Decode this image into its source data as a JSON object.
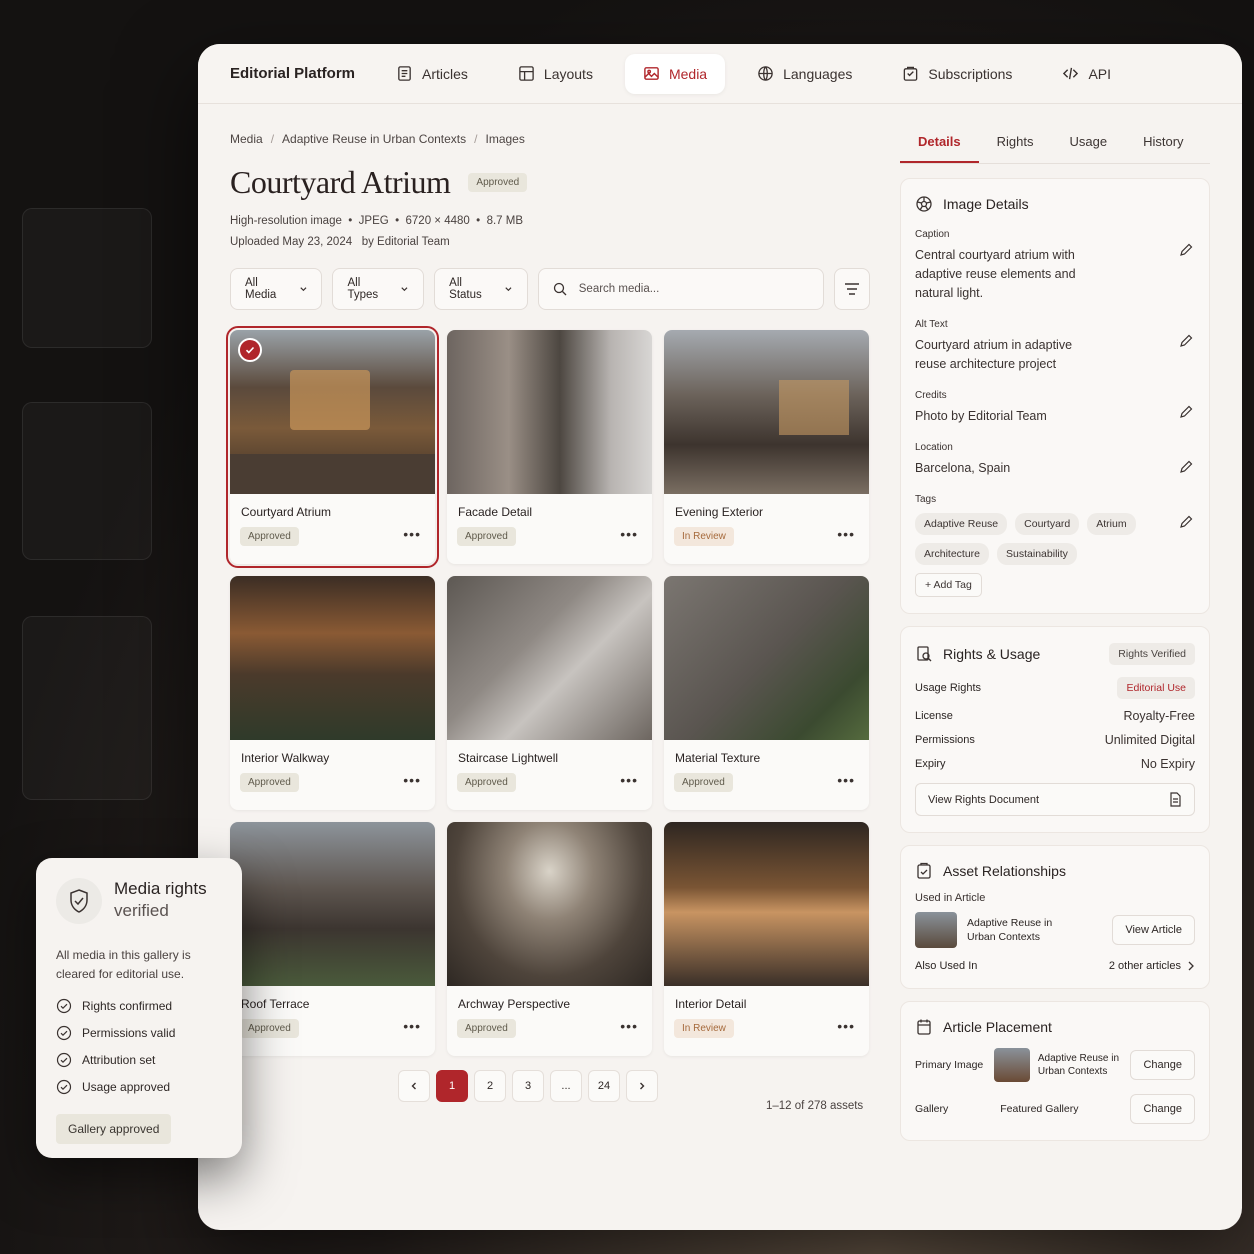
{
  "app": {
    "brand": "Editorial Platform"
  },
  "nav": [
    {
      "label": "Articles",
      "icon": "articles-icon"
    },
    {
      "label": "Layouts",
      "icon": "layouts-icon"
    },
    {
      "label": "Media",
      "icon": "image-icon",
      "active": true
    },
    {
      "label": "Languages",
      "icon": "globe-icon"
    },
    {
      "label": "Subscriptions",
      "icon": "box-icon"
    },
    {
      "label": "API",
      "icon": "code-icon"
    }
  ],
  "breadcrumb": [
    "Media",
    "Adaptive Reuse in Urban Contexts",
    "Images"
  ],
  "asset": {
    "title": "Courtyard Atrium",
    "status": "Approved",
    "meta": "High-resolution image  •  JPEG  •  6720 × 4480  •  8.7 MB",
    "uploaded": "Uploaded May 23, 2024   by Editorial Team"
  },
  "filters": {
    "media": "All Media",
    "types": "All Types",
    "status": "All Status",
    "search_placeholder": "Search media..."
  },
  "cards": [
    {
      "name": "Courtyard Atrium",
      "status": "Approved",
      "selected": true
    },
    {
      "name": "Facade Detail",
      "status": "Approved"
    },
    {
      "name": "Evening Exterior",
      "status": "In Review"
    },
    {
      "name": "Interior Walkway",
      "status": "Approved"
    },
    {
      "name": "Staircase Lightwell",
      "status": "Approved"
    },
    {
      "name": "Material Texture",
      "status": "Approved"
    },
    {
      "name": "Roof Terrace",
      "status": "Approved"
    },
    {
      "name": "Archway Perspective",
      "status": "Approved"
    },
    {
      "name": "Interior Detail",
      "status": "In Review"
    }
  ],
  "pagination": {
    "pages": [
      "1",
      "2",
      "3",
      "...",
      "24"
    ],
    "current": "1",
    "count": "1–12 of 278 assets"
  },
  "tabs": [
    "Details",
    "Rights",
    "Usage",
    "History"
  ],
  "details": {
    "heading": "Image Details",
    "caption_label": "Caption",
    "caption": "Central courtyard atrium with adaptive reuse elements and natural light.",
    "alt_label": "Alt Text",
    "alt": "Courtyard atrium in adaptive reuse architecture project",
    "credits_label": "Credits",
    "credits": "Photo by Editorial Team",
    "location_label": "Location",
    "location": "Barcelona, Spain",
    "tags_label": "Tags",
    "tags": [
      "Adaptive Reuse",
      "Courtyard",
      "Atrium",
      "Architecture",
      "Sustainability"
    ],
    "add_tag": "Add Tag"
  },
  "rights": {
    "heading": "Rights & Usage",
    "badge": "Rights Verified",
    "usage_label": "Usage Rights",
    "usage": "Editorial Use",
    "license_label": "License",
    "license": "Royalty-Free",
    "permissions_label": "Permissions",
    "permissions": "Unlimited Digital",
    "expiry_label": "Expiry",
    "expiry": "No Expiry",
    "doc_button": "View Rights Document"
  },
  "relationships": {
    "heading": "Asset Relationships",
    "used_label": "Used in Article",
    "article": "Adaptive Reuse in Urban Contexts",
    "view_button": "View Article",
    "also_label": "Also Used In",
    "also": "2 other articles"
  },
  "placement": {
    "heading": "Article Placement",
    "primary_label": "Primary Image",
    "primary": "Adaptive Reuse in Urban Contexts",
    "change": "Change",
    "gallery_label": "Gallery",
    "gallery": "Featured Gallery"
  },
  "floater": {
    "title": "Media rights",
    "subtitle": "verified",
    "text": "All media in this gallery is cleared for editorial use.",
    "items": [
      "Rights confirmed",
      "Permissions valid",
      "Attribution set",
      "Usage approved"
    ],
    "button": "Gallery approved"
  },
  "colors": {
    "accent": "#b0262b",
    "background": "#f6f3f0"
  }
}
